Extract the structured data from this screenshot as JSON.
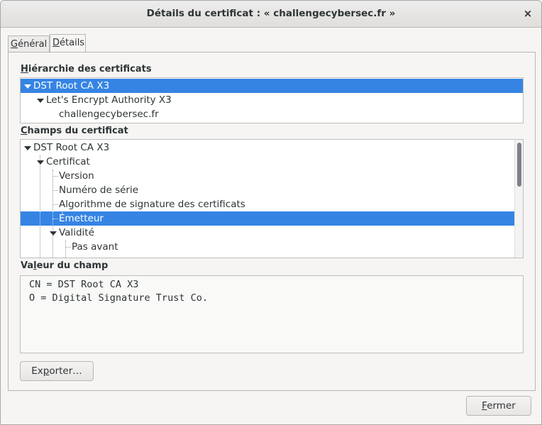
{
  "window": {
    "title": "Détails du certificat : « challengecybersec.fr »",
    "close_icon": "×"
  },
  "tabs": [
    {
      "label": "Général",
      "mnemonic": "G",
      "rest": "énéral",
      "selected": false
    },
    {
      "label": "Détails",
      "mnemonic": "D",
      "rest": "étails",
      "selected": true
    }
  ],
  "hierarchy": {
    "label_mnemonic": "H",
    "label_rest": "iérarchie des certificats",
    "items": [
      {
        "label": "DST Root CA X3",
        "level": 0,
        "expanded": true,
        "selected": true
      },
      {
        "label": "Let's Encrypt Authority X3",
        "level": 1,
        "expanded": true,
        "selected": false
      },
      {
        "label": "challengecybersec.fr",
        "level": 2,
        "expanded": false,
        "selected": false
      }
    ]
  },
  "fields": {
    "label_mnemonic": "C",
    "label_rest": "hamps du certificat",
    "items": [
      {
        "label": "DST Root CA X3",
        "level": 0,
        "expandable": true
      },
      {
        "label": "Certificat",
        "level": 1,
        "expandable": true
      },
      {
        "label": "Version",
        "level": 2,
        "expandable": false
      },
      {
        "label": "Numéro de série",
        "level": 2,
        "expandable": false
      },
      {
        "label": "Algorithme de signature des certificats",
        "level": 2,
        "expandable": false
      },
      {
        "label": "Émetteur",
        "level": 2,
        "expandable": false,
        "selected": true
      },
      {
        "label": "Validité",
        "level": 2,
        "expandable": true
      },
      {
        "label": "Pas avant",
        "level": 3,
        "expandable": false
      }
    ]
  },
  "value": {
    "label_pre": "Va",
    "label_mnemonic": "l",
    "label_rest": "eur du champ",
    "lines": [
      "CN = DST Root CA X3",
      "O = Digital Signature Trust Co."
    ]
  },
  "buttons": {
    "export_pre": "Ex",
    "export_mnemonic": "p",
    "export_rest": "orter…",
    "close_mnemonic": "F",
    "close_rest": "ermer"
  },
  "colors": {
    "selection": "#3584e4",
    "window_bg": "#f6f5f4"
  }
}
